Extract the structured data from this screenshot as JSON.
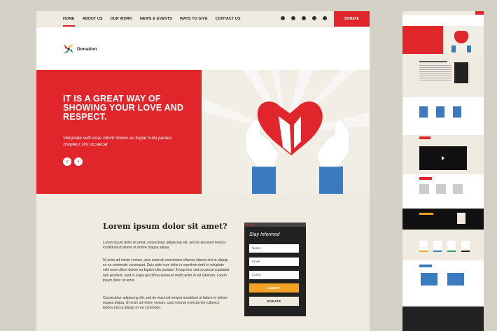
{
  "nav": {
    "links": [
      {
        "label": "HOME"
      },
      {
        "label": "ABOUT US"
      },
      {
        "label": "OUR WORK"
      },
      {
        "label": "NEWS & EVENTS"
      },
      {
        "label": "WAYS TO GIVE"
      },
      {
        "label": "CONTACT US"
      }
    ],
    "icons": [
      "user-icon",
      "phone-icon",
      "location-icon",
      "video-icon",
      "chat-icon"
    ],
    "donate_label": "DONATE"
  },
  "logo": {
    "text": "Donation"
  },
  "hero": {
    "title": "IT IS A GREAT WAY OF SHOWING YOUR LOVE AND RESPECT.",
    "subtitle": "Voluptate velit esse cillum dolore eu fugiat nulla pariatu xcepteur sint occaecat",
    "prev": "‹",
    "next": "›"
  },
  "content": {
    "title": "Lorem ipsum dolor sit amet?",
    "p1": "Lorem ipsum dolor sit amet, consectetur adipiscing elit, sed do eiusmod tempor incididunt ut labore et dolore magna aliqua.",
    "p2": "Ut enim ad minim veniam, quis nostrud exercitation ullamco laboris nisi ut aliquip ex ea commodo consequat. Duis aute irure dolor in reprehen-derit in voluptate velit esse cillum dolore eu fugiat nulla pariatur. Excep-teur sint occaecat cupidatat non proident, sunt in culpa qui officia deserunt mollit anim id est laborum. Lorem ipsum dolor sit amet.",
    "p3": "Consectetur adipiscing elit, sed do eiusmod tempor incididunt ut labore et dolore magna aliqua. Ut enim ad minim veniam, quis nostrud exercita-tion ullamco laboris nisi ut aliquip ex ea commodo."
  },
  "widget": {
    "title": "Stay Informed",
    "name_placeholder": "Name",
    "email_placeholder": "Email",
    "country_placeholder": "Contry",
    "submit_label": "SUBMIT",
    "donate_label": "DONATE"
  },
  "colors": {
    "accent": "#e0262b",
    "cream": "#efebe0",
    "orange": "#f0a327",
    "dark": "#222222",
    "blue": "#3a7bbf"
  }
}
